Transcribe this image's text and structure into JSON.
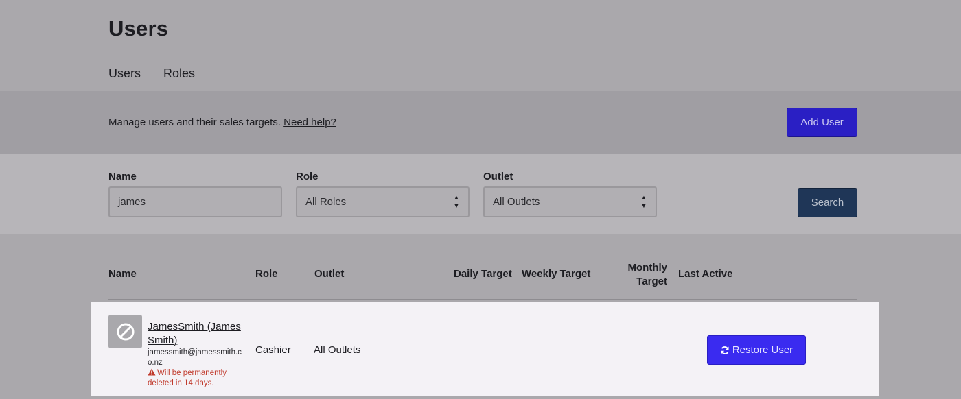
{
  "page": {
    "title": "Users"
  },
  "tabs": [
    {
      "label": "Users"
    },
    {
      "label": "Roles"
    }
  ],
  "manage": {
    "text": "Manage users and their sales targets.",
    "help_link": "Need help?",
    "add_user_label": "Add User"
  },
  "filters": {
    "name_label": "Name",
    "name_value": "james",
    "role_label": "Role",
    "role_value": "All Roles",
    "outlet_label": "Outlet",
    "outlet_value": "All Outlets",
    "search_label": "Search"
  },
  "table": {
    "headers": {
      "name": "Name",
      "role": "Role",
      "outlet": "Outlet",
      "daily": "Daily Target",
      "weekly": "Weekly Target",
      "monthly_line1": "Monthly",
      "monthly_line2": "Target",
      "last_active": "Last Active"
    },
    "rows": [
      {
        "avatar_icon": "ban-icon",
        "name": "JamesSmith (James Smith)",
        "email": "jamessmith@jamessmith.co.nz",
        "warning": "Will be permanently deleted in 14 days.",
        "warning_icon": "warning-triangle-icon",
        "role": "Cashier",
        "outlet": "All Outlets",
        "restore_label": "Restore User",
        "restore_icon": "refresh-icon"
      }
    ]
  },
  "colors": {
    "primary": "#3a2bf0",
    "search": "#1f3657",
    "warning": "#c0392b"
  }
}
